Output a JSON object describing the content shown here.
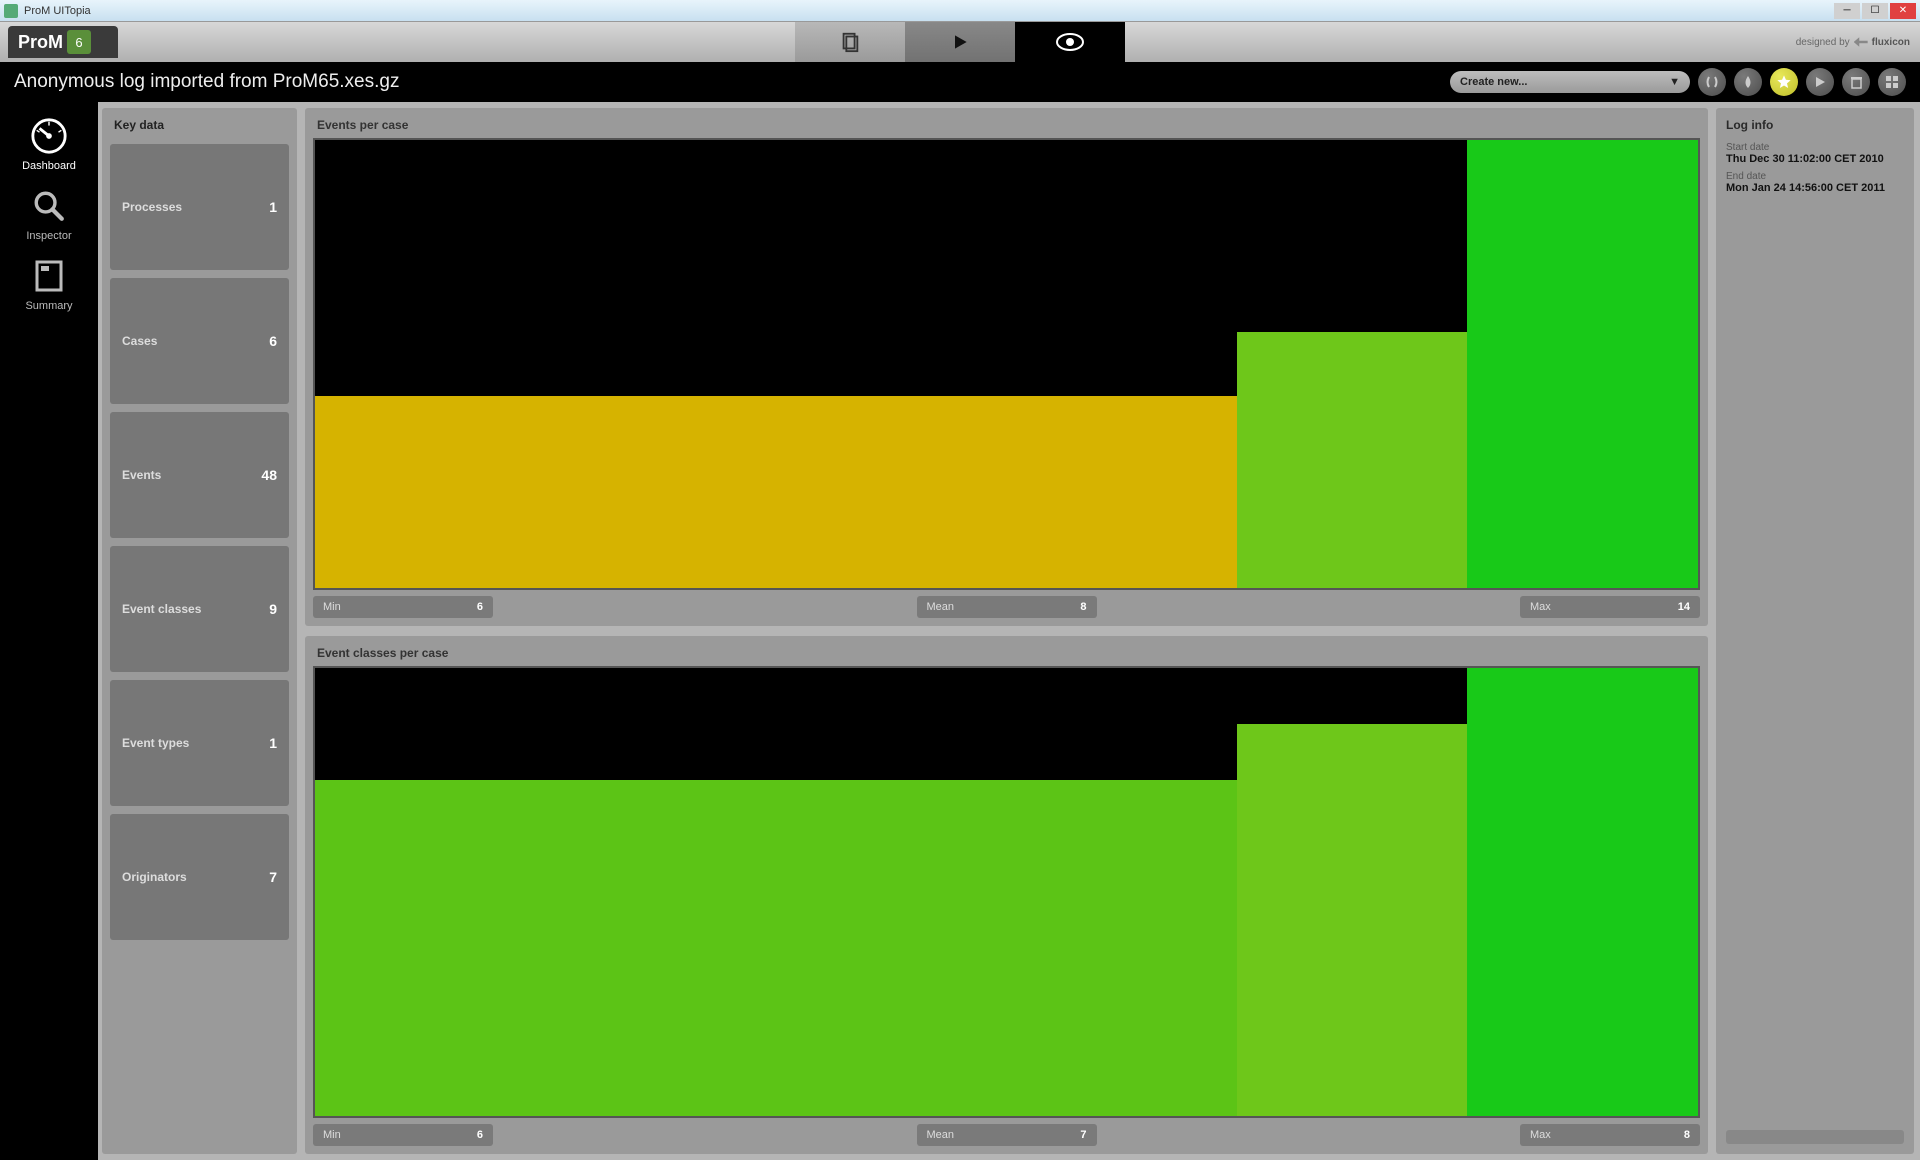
{
  "window": {
    "title": "ProM UITopia"
  },
  "branding": {
    "logo_text": "ProM",
    "logo_version": "6",
    "designed_by": "designed by",
    "vendor": "fluxicon"
  },
  "page_title": "Anonymous log imported from ProM65.xes.gz",
  "create_dropdown": {
    "label": "Create new..."
  },
  "left_nav": [
    {
      "key": "dashboard",
      "label": "Dashboard"
    },
    {
      "key": "inspector",
      "label": "Inspector"
    },
    {
      "key": "summary",
      "label": "Summary"
    }
  ],
  "keydata": {
    "title": "Key data",
    "items": [
      {
        "label": "Processes",
        "value": "1"
      },
      {
        "label": "Cases",
        "value": "6"
      },
      {
        "label": "Events",
        "value": "48"
      },
      {
        "label": "Event classes",
        "value": "9"
      },
      {
        "label": "Event types",
        "value": "1"
      },
      {
        "label": "Originators",
        "value": "7"
      }
    ]
  },
  "charts": {
    "events_per_case": {
      "title": "Events per case",
      "stats": {
        "min_label": "Min",
        "min": "6",
        "mean_label": "Mean",
        "mean": "8",
        "max_label": "Max",
        "max": "14"
      }
    },
    "event_classes_per_case": {
      "title": "Event classes per case",
      "stats": {
        "min_label": "Min",
        "min": "6",
        "mean_label": "Mean",
        "mean": "7",
        "max_label": "Max",
        "max": "8"
      }
    }
  },
  "chart_data": [
    {
      "type": "bar",
      "title": "Events per case",
      "categories": [
        "6",
        "8",
        "14"
      ],
      "values": [
        6,
        8,
        14
      ],
      "widths_fraction": [
        0.667,
        0.167,
        0.167
      ],
      "colors": [
        "#d6b300",
        "#6ec71a",
        "#18c918"
      ],
      "ylim": [
        0,
        14
      ],
      "xlabel": "",
      "ylabel": ""
    },
    {
      "type": "bar",
      "title": "Event classes per case",
      "categories": [
        "6",
        "7",
        "8"
      ],
      "values": [
        6,
        7,
        8
      ],
      "widths_fraction": [
        0.667,
        0.167,
        0.167
      ],
      "colors": [
        "#5cc416",
        "#6ec71a",
        "#18c918"
      ],
      "ylim": [
        0,
        8
      ],
      "xlabel": "",
      "ylabel": ""
    }
  ],
  "log_info": {
    "title": "Log info",
    "start_label": "Start date",
    "start_value": "Thu Dec 30 11:02:00 CET 2010",
    "end_label": "End date",
    "end_value": "Mon Jan 24 14:56:00 CET 2011"
  }
}
